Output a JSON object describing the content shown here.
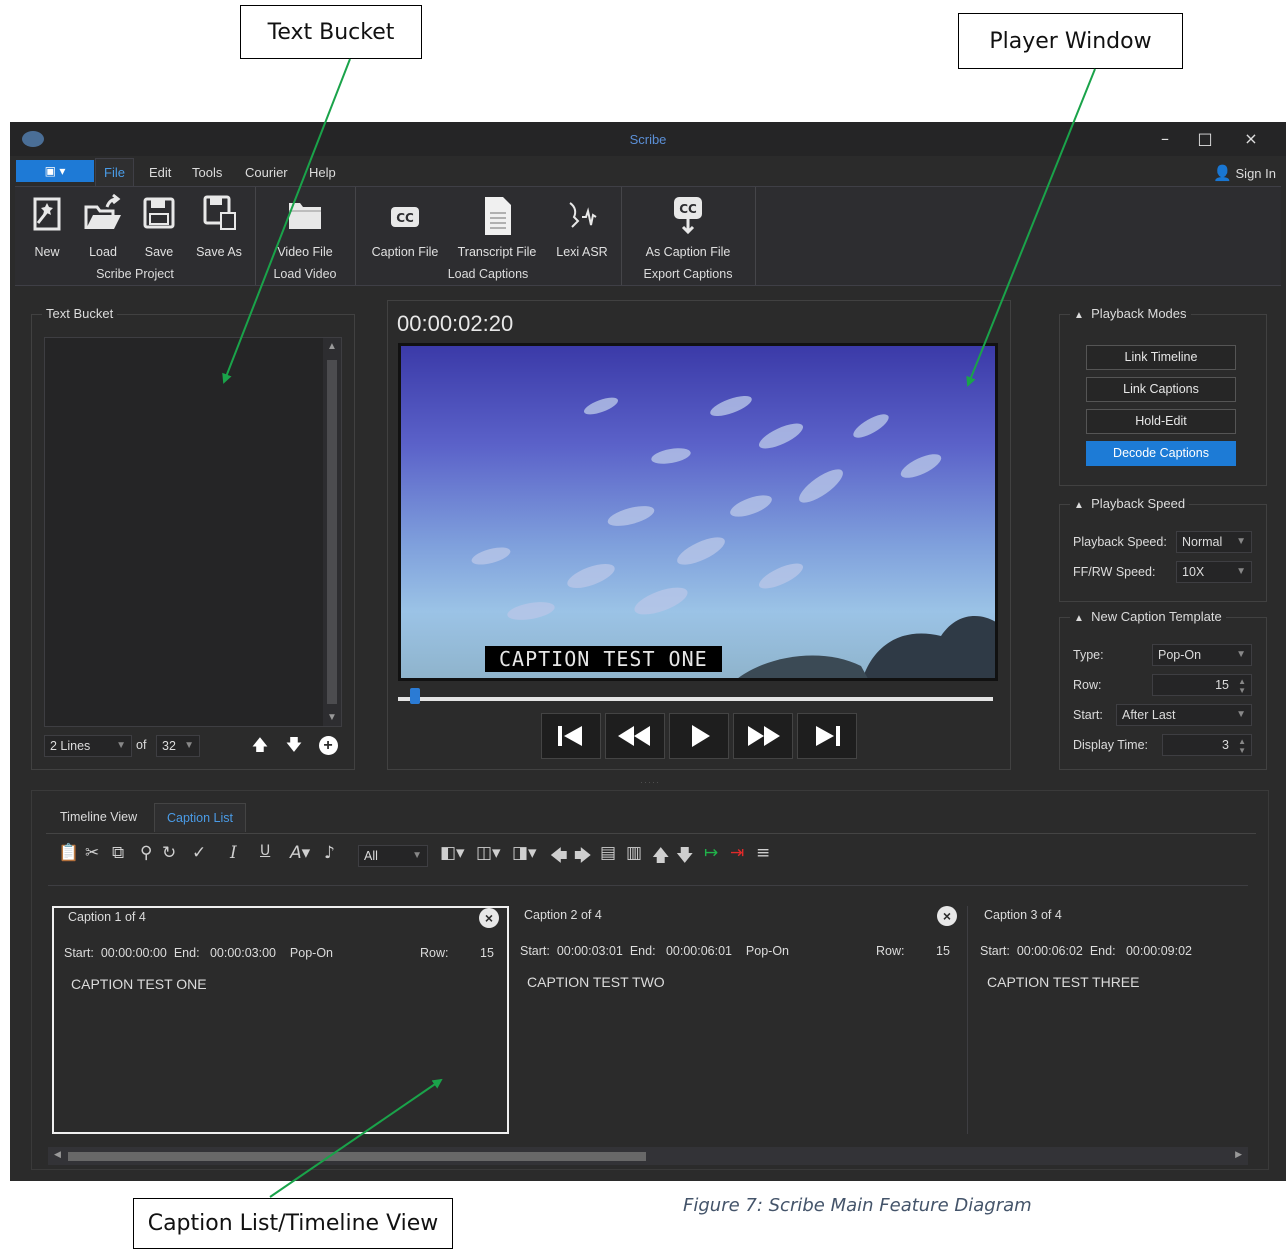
{
  "callouts": {
    "text_bucket": "Text Bucket",
    "player_window": "Player Window",
    "caption_list": "Caption List/Timeline View"
  },
  "figure_caption": "Figure 7:  Scribe Main Feature Diagram",
  "app": {
    "title": "Scribe",
    "window_controls": {
      "minimize": "–",
      "maximize": "□",
      "close": "×"
    },
    "signin": "Sign In",
    "menu": [
      "File",
      "Edit",
      "Tools",
      "Courier",
      "Help"
    ],
    "ribbon": {
      "groups": [
        {
          "label": "Scribe Project",
          "buttons": [
            "New",
            "Load",
            "Save",
            "Save As"
          ]
        },
        {
          "label": "Load Video",
          "buttons": [
            "Video File"
          ]
        },
        {
          "label": "Load Captions",
          "buttons": [
            "Caption File",
            "Transcript File",
            "Lexi ASR"
          ]
        },
        {
          "label": "Export Captions",
          "buttons": [
            "As Caption File"
          ]
        }
      ]
    },
    "text_bucket": {
      "title": "Text Bucket",
      "lines": "2 Lines",
      "of": "of",
      "total": "32"
    },
    "player": {
      "timecode": "00:00:02:20",
      "caption_overlay": "CAPTION TEST ONE",
      "progress": 0.01
    },
    "playback_modes": {
      "title": "Playback Modes",
      "buttons": [
        "Link Timeline",
        "Link Captions",
        "Hold-Edit",
        "Decode Captions"
      ],
      "active": "Decode Captions"
    },
    "playback_speed": {
      "title": "Playback Speed",
      "speed_label": "Playback Speed:",
      "speed_value": "Normal",
      "ffrw_label": "FF/RW Speed:",
      "ffrw_value": "10X"
    },
    "template": {
      "title": "New Caption Template",
      "type_label": "Type:",
      "type_value": "Pop-On",
      "row_label": "Row:",
      "row_value": "15",
      "start_label": "Start:",
      "start_value": "After Last",
      "display_label": "Display Time:",
      "display_value": "3"
    },
    "bottom": {
      "tabs": [
        "Timeline View",
        "Caption List"
      ],
      "active_tab": "Caption List",
      "filter": "All",
      "captions": [
        {
          "title": "Caption 1 of 4",
          "start_label": "Start:",
          "start": "00:00:00:00",
          "end_label": "End:",
          "end": "00:00:03:00",
          "type": "Pop-On",
          "row_label": "Row:",
          "row": "15",
          "text": "CAPTION TEST ONE"
        },
        {
          "title": "Caption 2 of 4",
          "start_label": "Start:",
          "start": "00:00:03:01",
          "end_label": "End:",
          "end": "00:00:06:01",
          "type": "Pop-On",
          "row_label": "Row:",
          "row": "15",
          "text": "CAPTION TEST TWO"
        },
        {
          "title": "Caption 3 of 4",
          "start_label": "Start:",
          "start": "00:00:06:02",
          "end_label": "End:",
          "end": "00:00:09:02",
          "text": "CAPTION TEST THREE"
        }
      ]
    }
  }
}
